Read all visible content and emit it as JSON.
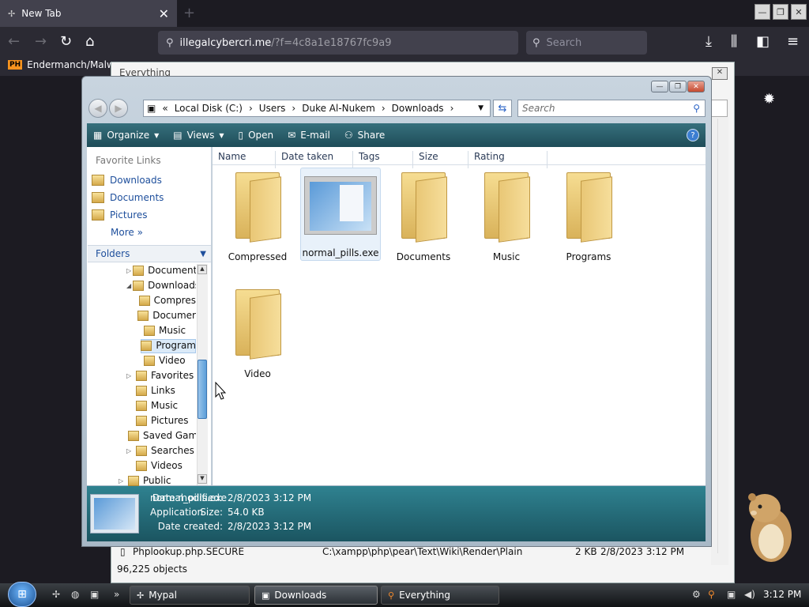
{
  "browser": {
    "tab_title": "New Tab",
    "tab_close": "✕",
    "new_tab": "+",
    "url_domain": "illegalcybercri.me",
    "url_path": "/?f=4c8a1e18767fc9a9",
    "search_placeholder": "Search",
    "bookmark": "Endermanch/Malwa",
    "bookmark_badge": "PH"
  },
  "bg_window": {
    "title": "Everything",
    "close_glyph": "✕",
    "row": {
      "name": "Phplookup.php.SECURE",
      "path": "C:\\xampp\\php\\pear\\Text\\Wiki\\Render\\Plain",
      "size": "2 KB",
      "date": "2/8/2023 3:12 PM"
    },
    "status": "96,225 objects"
  },
  "explorer": {
    "breadcrumb": [
      "«",
      "Local Disk (C:)",
      "›",
      "Users",
      "›",
      "Duke Al-Nukem",
      "›",
      "Downloads",
      "›"
    ],
    "search_placeholder": "Search",
    "commands": {
      "organize": "Organize",
      "views": "Views",
      "open": "Open",
      "email": "E-mail",
      "share": "Share",
      "help": "?"
    },
    "favorite_links_head": "Favorite Links",
    "favorite_links": [
      "Downloads",
      "Documents",
      "Pictures"
    ],
    "more": "More",
    "folders_head": "Folders",
    "tree": [
      {
        "label": "Document",
        "indent": 1,
        "twisty": "▷"
      },
      {
        "label": "Downloads",
        "indent": 1,
        "twisty": "◢"
      },
      {
        "label": "Compres",
        "indent": 2,
        "twisty": ""
      },
      {
        "label": "Documer",
        "indent": 2,
        "twisty": ""
      },
      {
        "label": "Music",
        "indent": 2,
        "twisty": ""
      },
      {
        "label": "Program",
        "indent": 2,
        "twisty": ""
      },
      {
        "label": "Video",
        "indent": 2,
        "twisty": ""
      },
      {
        "label": "Favorites",
        "indent": 1,
        "twisty": "▷"
      },
      {
        "label": "Links",
        "indent": 1,
        "twisty": ""
      },
      {
        "label": "Music",
        "indent": 1,
        "twisty": ""
      },
      {
        "label": "Pictures",
        "indent": 1,
        "twisty": ""
      },
      {
        "label": "Saved Gam",
        "indent": 1,
        "twisty": ""
      },
      {
        "label": "Searches",
        "indent": 1,
        "twisty": "▷"
      },
      {
        "label": "Videos",
        "indent": 1,
        "twisty": ""
      },
      {
        "label": "Public",
        "indent": 0,
        "twisty": "▷"
      }
    ],
    "columns": [
      "Name",
      "Date taken",
      "Tags",
      "Size",
      "Rating"
    ],
    "items": [
      "Compressed",
      "normal_pills.exe",
      "Documents",
      "Music",
      "Programs",
      "Video"
    ],
    "details": {
      "name": "normal_pills.exe",
      "type": "Application",
      "modified_label": "Date modified:",
      "modified_value": "2/8/2023 3:12 PM",
      "size_label": "Size:",
      "size_value": "54.0 KB",
      "created_label": "Date created:",
      "created_value": "2/8/2023 3:12 PM"
    }
  },
  "taskbar": {
    "buttons": [
      "Mypal",
      "Downloads",
      "Everything"
    ],
    "clock": "3:12 PM"
  }
}
